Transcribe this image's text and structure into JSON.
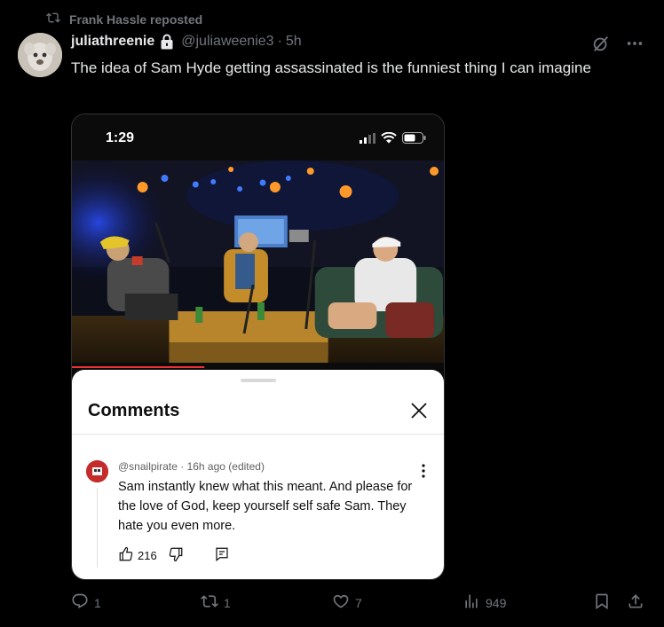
{
  "repost": {
    "text": "Frank Hassle reposted"
  },
  "tweet": {
    "display_name": "juliathreenie",
    "handle": "@juliaweenie3",
    "separator": "·",
    "time": "5h",
    "text": "The idea of Sam Hyde getting assassinated is the funniest thing I can imagine"
  },
  "media": {
    "status_time": "1:29",
    "comments_sheet": {
      "title": "Comments",
      "comment": {
        "author": "@snailpirate",
        "meta": "· 16h ago (edited)",
        "text": "Sam instantly knew what this meant. And please for the love of God, keep yourself self safe Sam. They hate you even more.",
        "likes": "216"
      }
    }
  },
  "actions": {
    "replies": "1",
    "reposts": "1",
    "likes": "7",
    "views": "949"
  },
  "icons": [
    "repost-icon",
    "lock-icon",
    "grok-icon",
    "more-icon",
    "signal-icon",
    "wifi-icon",
    "battery-icon",
    "close-icon",
    "thumbs-up-icon",
    "thumbs-down-icon",
    "reply-comment-icon",
    "reply-icon",
    "like-icon",
    "views-icon",
    "bookmark-icon",
    "share-icon"
  ],
  "colors": {
    "background": "#000000",
    "muted": "#71767b",
    "text": "#e7e9ea",
    "sheet": "#ffffff"
  }
}
